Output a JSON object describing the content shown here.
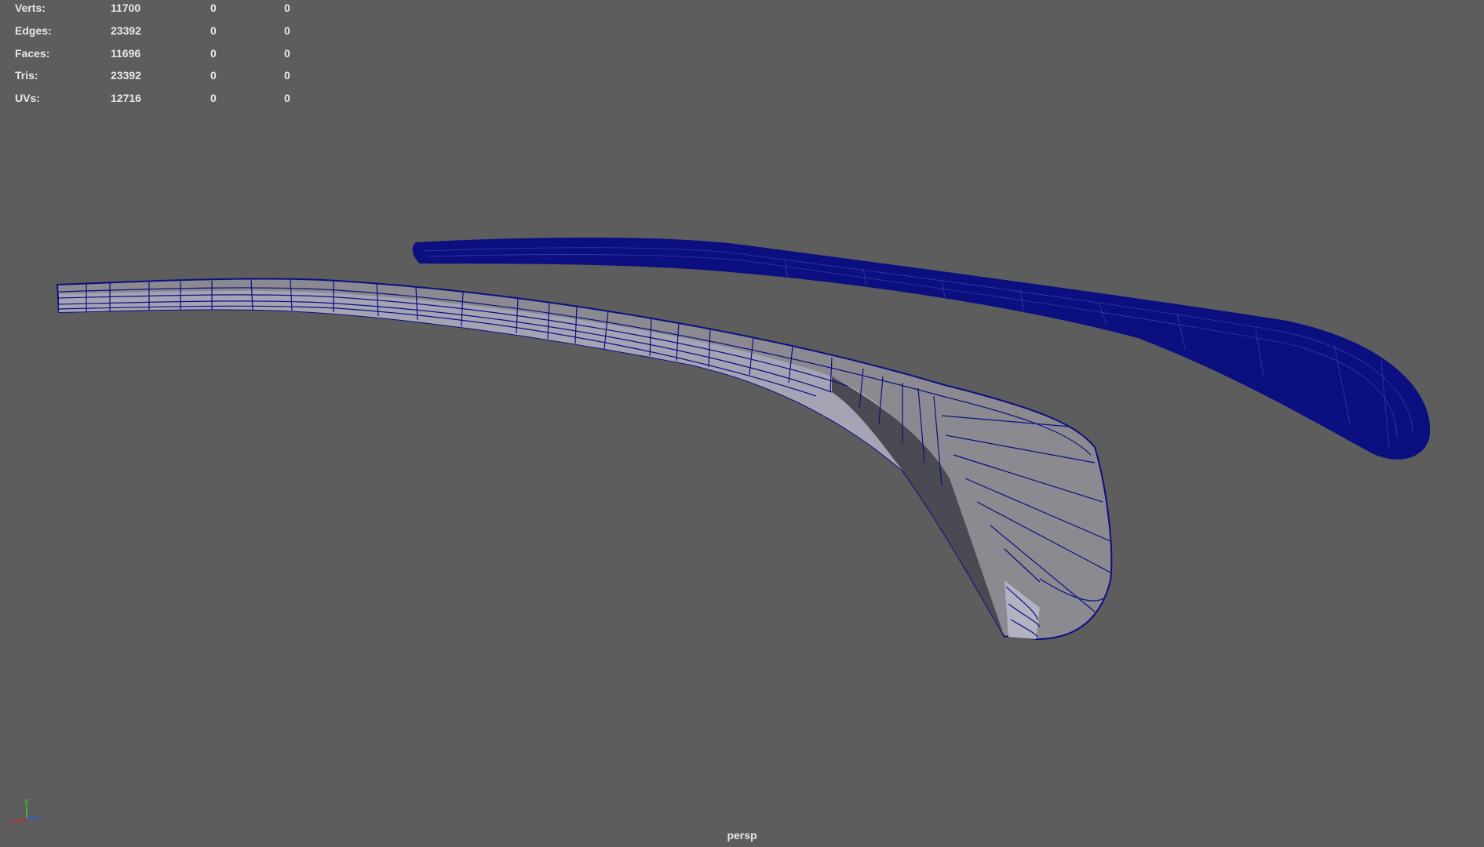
{
  "hud": {
    "rows": [
      {
        "label": "Verts:",
        "v1": "11700",
        "v2": "0",
        "v3": "0"
      },
      {
        "label": "Edges:",
        "v1": "23392",
        "v2": "0",
        "v3": "0"
      },
      {
        "label": "Faces:",
        "v1": "11696",
        "v2": "0",
        "v3": "0"
      },
      {
        "label": "Tris:",
        "v1": "23392",
        "v2": "0",
        "v3": "0"
      },
      {
        "label": "UVs:",
        "v1": "12716",
        "v2": "0",
        "v3": "0"
      }
    ]
  },
  "viewport": {
    "camera": "persp",
    "background_color": "#5d5d5d",
    "wire_color": "#0b0f80",
    "mesh_fill_color": "#7b7b80",
    "mesh_side_color": "#a7a7b8"
  },
  "axis": {
    "x_label": "x",
    "y_label": "y",
    "z_label": "z",
    "x_color": "#e02020",
    "y_color": "#2fd02f",
    "z_color": "#2a5cff"
  }
}
